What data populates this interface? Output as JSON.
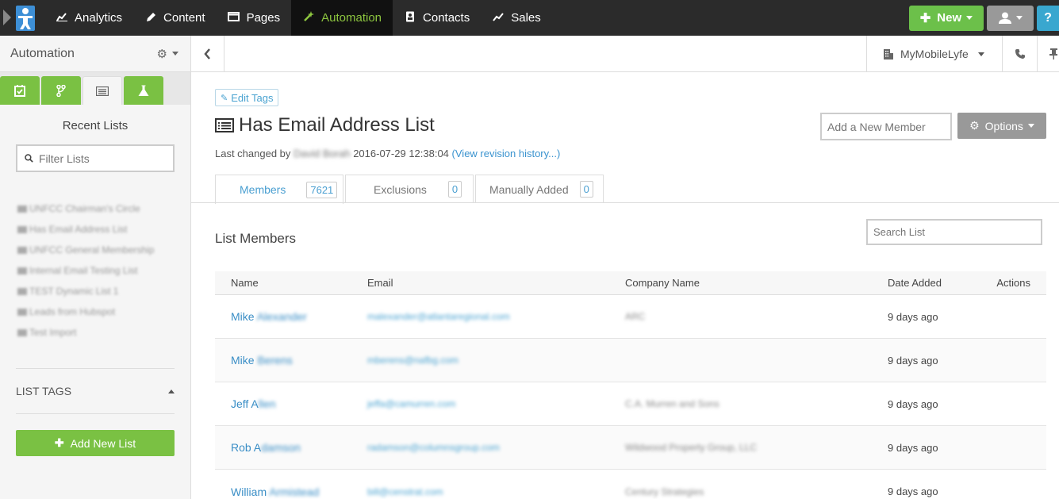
{
  "nav": {
    "items": [
      {
        "label": "Analytics",
        "icon": "chart-icon"
      },
      {
        "label": "Content",
        "icon": "pencil-icon"
      },
      {
        "label": "Pages",
        "icon": "window-icon"
      },
      {
        "label": "Automation",
        "icon": "magic-wand-icon"
      },
      {
        "label": "Contacts",
        "icon": "address-book-icon"
      },
      {
        "label": "Sales",
        "icon": "trend-icon"
      }
    ],
    "new_label": "New",
    "help_label": "?"
  },
  "colors": {
    "nav_bg": "#2b2b2b",
    "accent_green": "#7ac143",
    "new_button": "#6cc04a",
    "help_button": "#39a7cf",
    "link_blue": "#3a93cf"
  },
  "sidebar": {
    "title": "Automation",
    "section_title": "Recent Lists",
    "filter_placeholder": "Filter Lists",
    "lists": [
      "UNFCC Chairman's Circle",
      "Has Email Address List",
      "UNFCC General Membership",
      "Internal Email Testing List",
      "TEST Dynamic List 1",
      "Leads from Hubspot",
      "Test Import"
    ],
    "list_tags_label": "LIST TAGS",
    "add_list_label": "Add New List"
  },
  "toolbar": {
    "company": "MyMobileLyfe"
  },
  "main": {
    "edit_tags_label": "Edit Tags",
    "title": "Has Email Address List",
    "last_changed_prefix": "Last changed by",
    "last_changed_user": "David Borah",
    "last_changed_time": "2016-07-29 12:38:04",
    "revision_link": "(View revision history...)",
    "add_member_placeholder": "Add a New Member",
    "options_label": "Options",
    "tabs": [
      {
        "label": "Members",
        "count": "7621"
      },
      {
        "label": "Exclusions",
        "count": "0"
      },
      {
        "label": "Manually Added",
        "count": "0"
      }
    ],
    "section_title": "List Members",
    "search_placeholder": "Search List",
    "columns": [
      "Name",
      "Email",
      "Company Name",
      "Date Added",
      "Actions"
    ],
    "rows": [
      {
        "first": "Mike",
        "last": "Alexander",
        "email": "malexander@atlantaregional.com",
        "company": "ARC",
        "date": "9 days ago"
      },
      {
        "first": "Mike",
        "last": "Berens",
        "email": "mberens@nafbg.com",
        "company": "",
        "date": "9 days ago"
      },
      {
        "first": "Jeff A",
        "last": "llen",
        "email": "jeffa@camurren.com",
        "company": "C.A. Murren and Sons",
        "date": "9 days ago"
      },
      {
        "first": "Rob A",
        "last": "damson",
        "email": "radamson@columnsgroup.com",
        "company": "Wildwood Property Group, LLC",
        "date": "9 days ago"
      },
      {
        "first": "William",
        "last": " Armistead",
        "email": "bill@censtrat.com",
        "company": "Century Strategies",
        "date": "9 days ago"
      }
    ]
  }
}
